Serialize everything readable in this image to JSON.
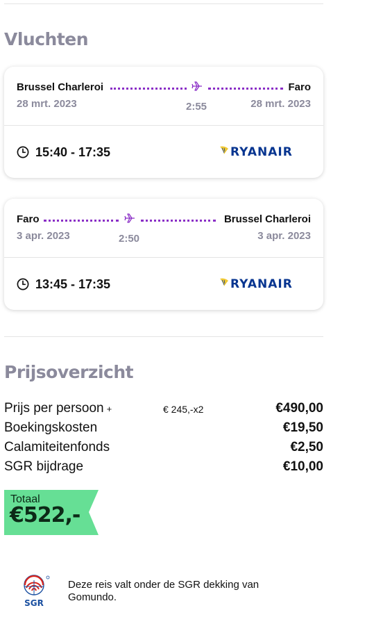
{
  "sections": {
    "flights_title": "Vluchten",
    "price_title": "Prijsoverzicht"
  },
  "flights": [
    {
      "from_city": "Brussel Charleroi",
      "to_city": "Faro",
      "from_date": "28 mrt. 2023",
      "to_date": "28 mrt. 2023",
      "duration": "2:55",
      "times": "15:40 - 17:35",
      "airline": "RYANAIR",
      "icons": {
        "route": "airplane-icon",
        "time": "clock-icon",
        "airline": "ryanair-harp-icon"
      }
    },
    {
      "from_city": "Faro",
      "to_city": "Brussel Charleroi",
      "from_date": "3 apr. 2023",
      "to_date": "3 apr. 2023",
      "duration": "2:50",
      "times": "13:45 - 17:35",
      "airline": "RYANAIR",
      "icons": {
        "route": "airplane-icon",
        "time": "clock-icon",
        "airline": "ryanair-harp-icon"
      }
    }
  ],
  "price_overview": {
    "rows": [
      {
        "label": "Prijs per persoon",
        "plus": "+",
        "detail": "€ 245,-x2",
        "value": "€490,00"
      },
      {
        "label": "Boekingskosten",
        "value": "€19,50"
      },
      {
        "label": "Calamiteitenfonds",
        "value": "€2,50"
      },
      {
        "label": "SGR bijdrage",
        "value": "€10,00"
      }
    ],
    "total_label": "Totaal",
    "total_value": "€522,-"
  },
  "sgr": {
    "logo_text": "SGR",
    "text": "Deze reis valt onder de SGR dekking van Gomundo."
  },
  "colors": {
    "accent_purple": "#8a2ec6",
    "muted_text": "#8b8a9c",
    "total_green": "#66df95",
    "ryanair_blue": "#073590",
    "ryanair_yellow": "#f1c933"
  }
}
